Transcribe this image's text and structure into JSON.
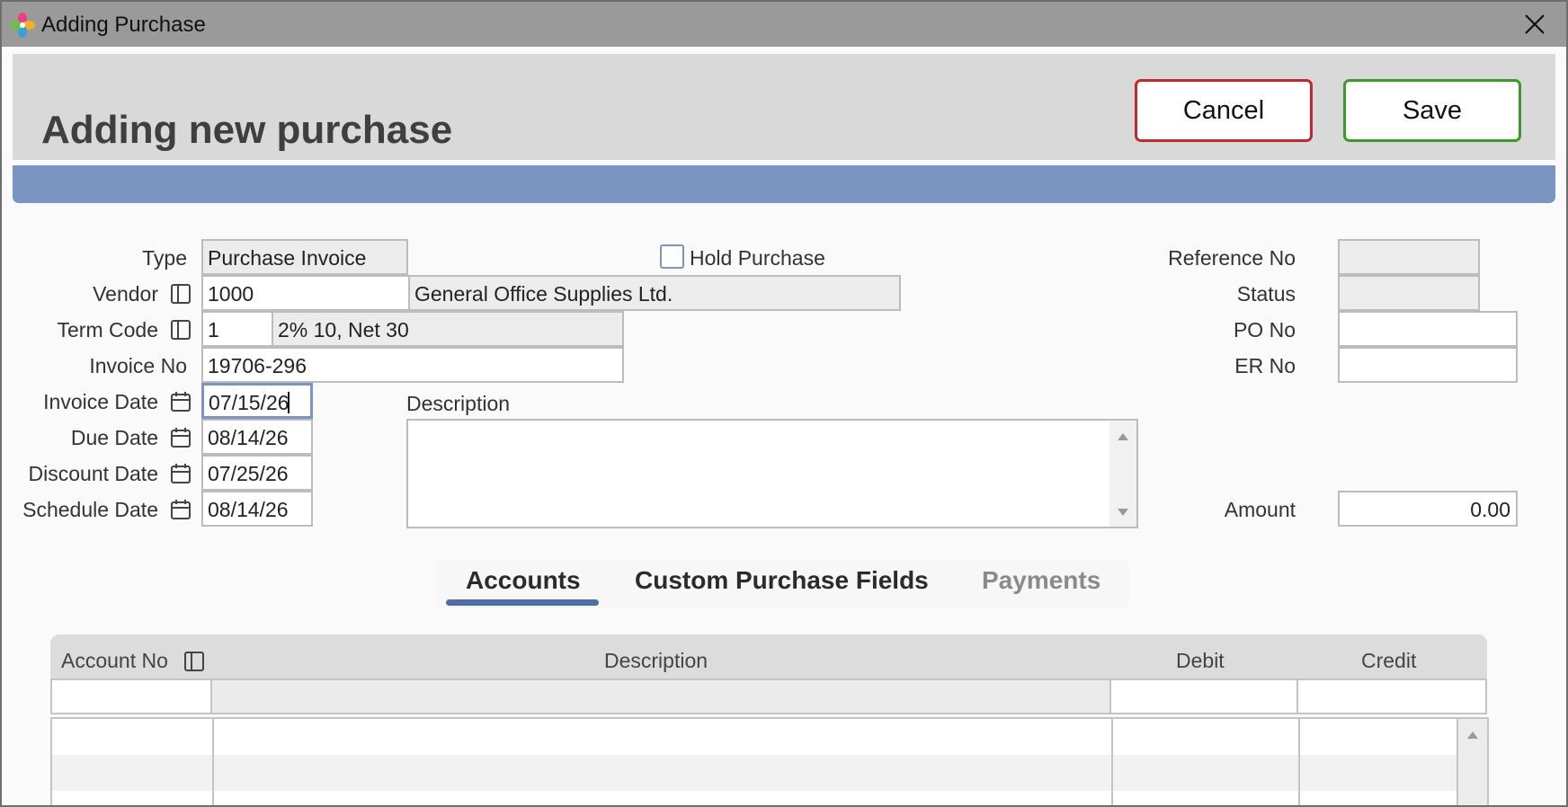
{
  "window": {
    "title": "Adding Purchase",
    "app_icon": "app-flower-icon",
    "close_icon": "close-icon"
  },
  "header": {
    "title": "Adding new purchase",
    "cancel_label": "Cancel",
    "save_label": "Save"
  },
  "colors": {
    "accent": "#7b95c3",
    "cancel_border": "#c0282d",
    "save_border": "#3a9a2c",
    "tab_underline": "#4f6ea7"
  },
  "form": {
    "type": {
      "label": "Type",
      "value": "Purchase Invoice"
    },
    "hold": {
      "label": "Hold Purchase",
      "checked": false
    },
    "vendor": {
      "label": "Vendor",
      "code": "1000",
      "name": "General Office Supplies Ltd.",
      "icon": "lookup-icon"
    },
    "term": {
      "label": "Term Code",
      "code": "1",
      "name": "2% 10, Net 30",
      "icon": "lookup-icon"
    },
    "invoice_no": {
      "label": "Invoice No",
      "value": "19706-296"
    },
    "invoice_date": {
      "label": "Invoice Date",
      "value": "07/15/26",
      "icon": "calendar-icon"
    },
    "due_date": {
      "label": "Due Date",
      "value": "08/14/26",
      "icon": "calendar-icon"
    },
    "discount_date": {
      "label": "Discount Date",
      "value": "07/25/26",
      "icon": "calendar-icon"
    },
    "schedule_date": {
      "label": "Schedule Date",
      "value": "08/14/26",
      "icon": "calendar-icon"
    },
    "description": {
      "label": "Description",
      "value": ""
    },
    "reference_no": {
      "label": "Reference No",
      "value": ""
    },
    "status": {
      "label": "Status",
      "value": ""
    },
    "po_no": {
      "label": "PO No",
      "value": ""
    },
    "er_no": {
      "label": "ER No",
      "value": ""
    },
    "amount": {
      "label": "Amount",
      "value": "0.00"
    }
  },
  "tabs": [
    {
      "label": "Accounts",
      "active": true
    },
    {
      "label": "Custom Purchase Fields",
      "active": false
    },
    {
      "label": "Payments",
      "active": false
    }
  ],
  "grid": {
    "columns": [
      {
        "label": "Account No",
        "icon": "lookup-icon"
      },
      {
        "label": "Description"
      },
      {
        "label": "Debit"
      },
      {
        "label": "Credit"
      }
    ],
    "rows": []
  }
}
